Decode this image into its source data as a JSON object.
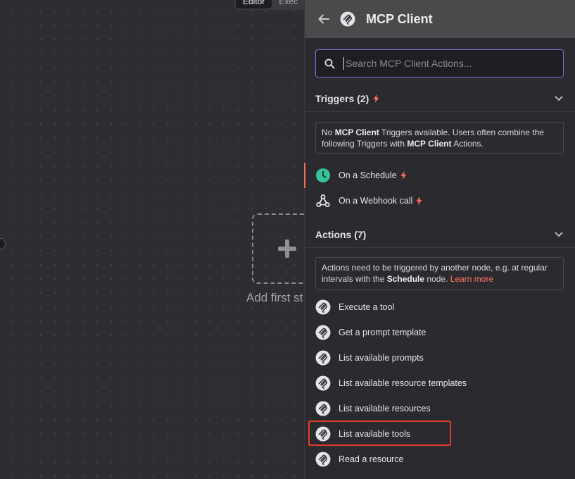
{
  "canvas": {
    "tabs": [
      "Editor",
      "Exec"
    ],
    "add_step_label": "Add first st"
  },
  "panel": {
    "title": "MCP Client",
    "search_placeholder": "Search MCP Client Actions...",
    "triggers": {
      "title": "Triggers (2)",
      "info_text": "No MCP Client Triggers available. Users often combine the following Triggers with MCP Client Actions.",
      "items": [
        {
          "label": "On a Schedule",
          "icon": "clock-icon"
        },
        {
          "label": "On a Webhook call",
          "icon": "webhook-icon"
        }
      ]
    },
    "actions": {
      "title": "Actions (7)",
      "info_text": "Actions need to be triggered by another node, e.g. at regular intervals with the Schedule node.",
      "learn_more": "Learn more",
      "items": [
        {
          "label": "Execute a tool"
        },
        {
          "label": "Get a prompt template"
        },
        {
          "label": "List available prompts"
        },
        {
          "label": "List available resource templates"
        },
        {
          "label": "List available resources"
        },
        {
          "label": "List available tools"
        },
        {
          "label": "Read a resource"
        }
      ]
    }
  },
  "colors": {
    "accent": "#ff6d5a",
    "focus": "#7c6fe0",
    "schedule": "#35c49a",
    "highlight": "#e03d2a"
  }
}
